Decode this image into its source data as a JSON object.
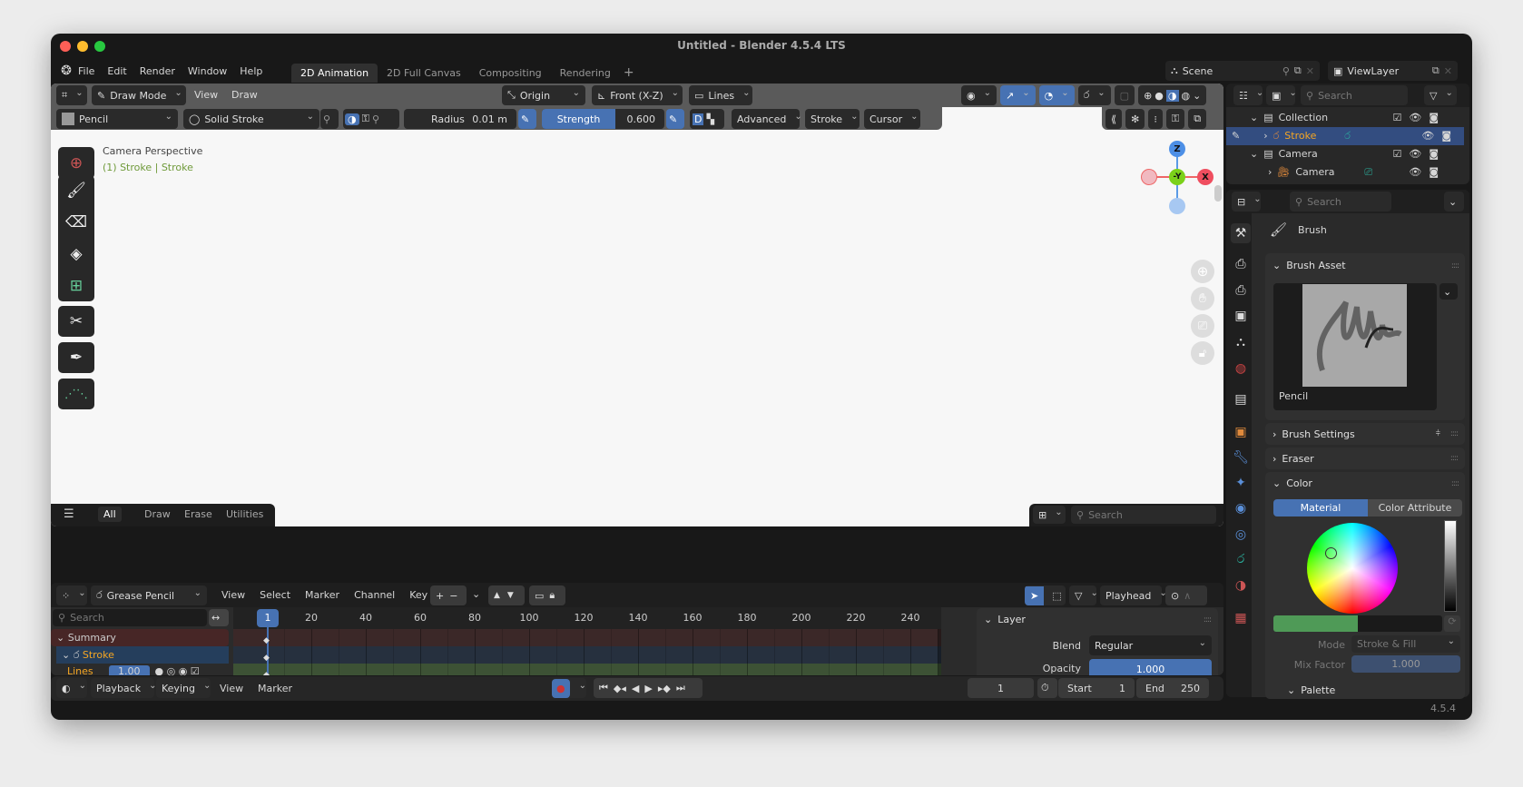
{
  "window": {
    "title": "Untitled - Blender 4.5.4 LTS",
    "version": "4.5.4"
  },
  "menu": [
    "File",
    "Edit",
    "Render",
    "Window",
    "Help"
  ],
  "workspaces": {
    "tabs": [
      "2D Animation",
      "2D Full Canvas",
      "Compositing",
      "Rendering"
    ],
    "active": "2D Animation",
    "add": "+"
  },
  "scene": {
    "name": "Scene",
    "view_layer": "ViewLayer"
  },
  "viewport_header": {
    "mode": "Draw Mode",
    "menus": [
      "View",
      "Draw"
    ],
    "pivot": "Origin",
    "orientation": "Front (X-Z)",
    "placement": "Lines"
  },
  "tool_settings": {
    "brush": "Pencil",
    "material": "Solid Stroke",
    "radius_label": "Radius",
    "radius_value": "0.01 m",
    "strength_label": "Strength",
    "strength_value": "0.600",
    "advanced": "Advanced",
    "stroke": "Stroke",
    "cursor": "Cursor"
  },
  "viewport": {
    "view_name": "Camera Perspective",
    "context": "(1) Stroke | Stroke",
    "gizmo": {
      "z": "Z",
      "y": "-Y",
      "x": "X"
    }
  },
  "toolbar": [
    "cursor",
    "draw",
    "erase",
    "fill",
    "add-primitive",
    "cutter",
    "eyedropper",
    "interpolate"
  ],
  "asset_shelf": {
    "tabs": [
      "All",
      "Draw",
      "Erase",
      "Utilities"
    ],
    "active_tab": "All",
    "search_placeholder": "Search",
    "selected_index": 6
  },
  "dopesheet": {
    "mode": "Grease Pencil",
    "menus": [
      "View",
      "Select",
      "Marker",
      "Channel",
      "Key"
    ],
    "search_placeholder": "Search",
    "snap": "Playhead",
    "current_frame": "1",
    "ticks": [
      "20",
      "40",
      "60",
      "80",
      "100",
      "120",
      "140",
      "160",
      "180",
      "200",
      "220",
      "240"
    ],
    "channels": {
      "summary": "Summary",
      "object": "Stroke",
      "layer": "Lines",
      "layer_opacity": "1.00"
    },
    "layer_panel": {
      "title": "Layer",
      "blend_label": "Blend",
      "blend_value": "Regular",
      "opacity_label": "Opacity",
      "opacity_value": "1.000"
    }
  },
  "timeline": {
    "menus": [
      "Playback",
      "Keying",
      "View",
      "Marker"
    ],
    "current_frame": "1",
    "start_label": "Start",
    "start": "1",
    "end_label": "End",
    "end": "250"
  },
  "outliner": {
    "search_placeholder": "Search",
    "rows": [
      {
        "name": "Collection",
        "type": "collection"
      },
      {
        "name": "Stroke",
        "type": "grease-pencil",
        "selected": true
      },
      {
        "name": "Camera",
        "type": "collection"
      },
      {
        "name": "Camera",
        "type": "camera"
      }
    ]
  },
  "properties": {
    "search_placeholder": "Search",
    "title": "Brush",
    "brush_asset": "Brush Asset",
    "brush_name": "Pencil",
    "brush_settings": "Brush Settings",
    "eraser": "Eraser",
    "color": "Color",
    "color_tabs": [
      "Material",
      "Color Attribute"
    ],
    "active_color_tab": "Material",
    "mode_label": "Mode",
    "mode_value": "Stroke & Fill",
    "mix_label": "Mix Factor",
    "mix_value": "1.000",
    "palette": "Palette",
    "primary_color": "#4f9a57",
    "secondary_color": "#1a1a1a"
  }
}
